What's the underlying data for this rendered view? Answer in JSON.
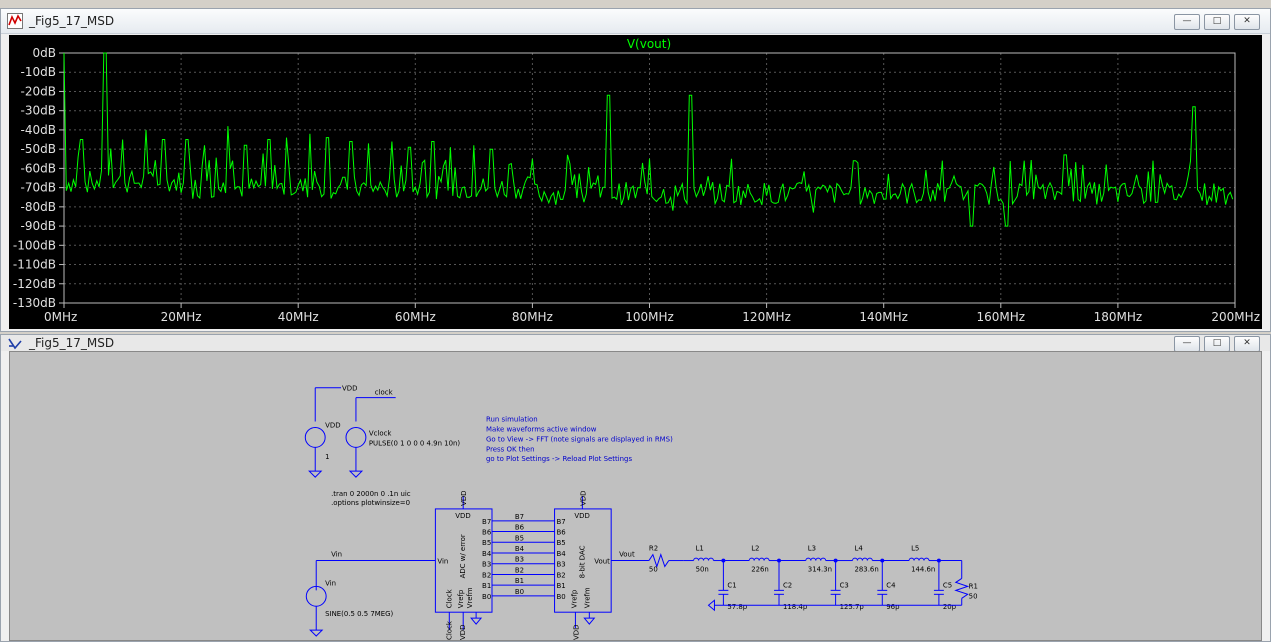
{
  "window_top": {
    "title": "_Fig5_17_MSD",
    "min": "—",
    "max": "□",
    "close": "✕"
  },
  "window_bottom": {
    "title": "_Fig5_17_MSD",
    "min": "—",
    "max": "□",
    "close": "✕"
  },
  "chart_data": {
    "type": "line",
    "title": "V(vout)",
    "xlabel": "",
    "ylabel": "",
    "xlim": [
      0,
      200
    ],
    "ylim": [
      -130,
      0
    ],
    "x_ticks": [
      "0MHz",
      "20MHz",
      "40MHz",
      "60MHz",
      "80MHz",
      "100MHz",
      "120MHz",
      "140MHz",
      "160MHz",
      "180MHz",
      "200MHz"
    ],
    "y_ticks": [
      "0dB",
      "-10dB",
      "-20dB",
      "-30dB",
      "-40dB",
      "-50dB",
      "-60dB",
      "-70dB",
      "-80dB",
      "-90dB",
      "-100dB",
      "-110dB",
      "-120dB",
      "-130dB"
    ],
    "grid": true,
    "line_color": "#00ff00",
    "series": [
      {
        "values": {
          "noise_floor_db": -70,
          "peaks": [
            {
              "x": 0,
              "y": 0
            },
            {
              "x": 7,
              "y": 0
            },
            {
              "x": 14,
              "y": -40
            },
            {
              "x": 28,
              "y": -38
            },
            {
              "x": 93,
              "y": -22
            },
            {
              "x": 107,
              "y": -22
            },
            {
              "x": 193,
              "y": -28
            },
            {
              "x": 3,
              "y": -45
            },
            {
              "x": 10,
              "y": -45
            },
            {
              "x": 17,
              "y": -45
            },
            {
              "x": 21,
              "y": -45
            },
            {
              "x": 24,
              "y": -48
            },
            {
              "x": 31,
              "y": -48
            },
            {
              "x": 35,
              "y": -45
            },
            {
              "x": 38,
              "y": -44
            },
            {
              "x": 42,
              "y": -42
            },
            {
              "x": 45,
              "y": -44
            },
            {
              "x": 49,
              "y": -46
            },
            {
              "x": 52,
              "y": -47
            },
            {
              "x": 56,
              "y": -46
            },
            {
              "x": 59,
              "y": -49
            },
            {
              "x": 63,
              "y": -46
            },
            {
              "x": 66,
              "y": -49
            },
            {
              "x": 70,
              "y": -48
            },
            {
              "x": 73,
              "y": -50
            },
            {
              "x": 80,
              "y": -55
            },
            {
              "x": 86,
              "y": -53
            },
            {
              "x": 100,
              "y": -55
            },
            {
              "x": 114,
              "y": -55
            },
            {
              "x": 128,
              "y": -52
            },
            {
              "x": 135,
              "y": -56
            },
            {
              "x": 150,
              "y": -56
            },
            {
              "x": 164,
              "y": -56
            },
            {
              "x": 171,
              "y": -53
            },
            {
              "x": 178,
              "y": -58
            },
            {
              "x": 186,
              "y": -56
            }
          ],
          "dips": [
            {
              "x": 155,
              "y": -90
            },
            {
              "x": 161,
              "y": -90
            },
            {
              "x": 104,
              "y": -82
            },
            {
              "x": 128,
              "y": -83
            }
          ]
        }
      }
    ]
  },
  "schematic": {
    "vdd_net": "VDD",
    "vdd_source": {
      "name": "VDD",
      "value": "1"
    },
    "clock_net": "clock",
    "clock_source": {
      "name": "Vclock",
      "value": "PULSE(0 1 0 0 0 4.9n 10n)"
    },
    "instructions": [
      "Run simulation",
      "Make waveforms active window",
      "Go to View -> FFT (note signals are displayed in RMS)",
      "Press OK then",
      "go to Plot Settings -> Reload Plot Settings"
    ],
    "directives": [
      ".tran 0 2000n 0 .1n uic",
      ".options plotwinsize=0"
    ],
    "vin_net": "Vin",
    "vin_source": {
      "name": "Vin",
      "value": "SINE(0.5 0.5 7MEG)"
    },
    "adc": {
      "label": "ADC w/ error",
      "vdd": "VDD",
      "vin": "Vin",
      "clock": "Clock",
      "vrefp": "Vrefp",
      "vrefm": "Vrefm",
      "bits": [
        "B7",
        "B6",
        "B5",
        "B4",
        "B3",
        "B2",
        "B1",
        "B0"
      ],
      "top_net": "VDD",
      "bottom_nets": [
        "Clock",
        "VDD"
      ]
    },
    "dac": {
      "label": "8-bit DAC",
      "vdd": "VDD",
      "vout": "Vout",
      "vrefp": "Vrefp",
      "vrefm": "Vrefm",
      "bits": [
        "B7",
        "B6",
        "B5",
        "B4",
        "B3",
        "B2",
        "B1",
        "B0"
      ],
      "top_net": "VDD",
      "bottom_net": "VDD"
    },
    "wire_bits": [
      "B7",
      "B6",
      "B5",
      "B4",
      "B3",
      "B2",
      "B1",
      "B0"
    ],
    "vout_net": "Vout",
    "r2": {
      "name": "R2",
      "value": "50"
    },
    "inductors": [
      {
        "name": "L1",
        "value": "50n"
      },
      {
        "name": "L2",
        "value": "226n"
      },
      {
        "name": "L3",
        "value": "314.3n"
      },
      {
        "name": "L4",
        "value": "283.6n"
      },
      {
        "name": "L5",
        "value": "144.6n"
      }
    ],
    "capacitors": [
      {
        "name": "C1",
        "value": "57.8p"
      },
      {
        "name": "C2",
        "value": "118.4p"
      },
      {
        "name": "C3",
        "value": "125.7p"
      },
      {
        "name": "C4",
        "value": "96p"
      },
      {
        "name": "C5",
        "value": "20p"
      }
    ],
    "r1": {
      "name": "R1",
      "value": "50"
    }
  }
}
